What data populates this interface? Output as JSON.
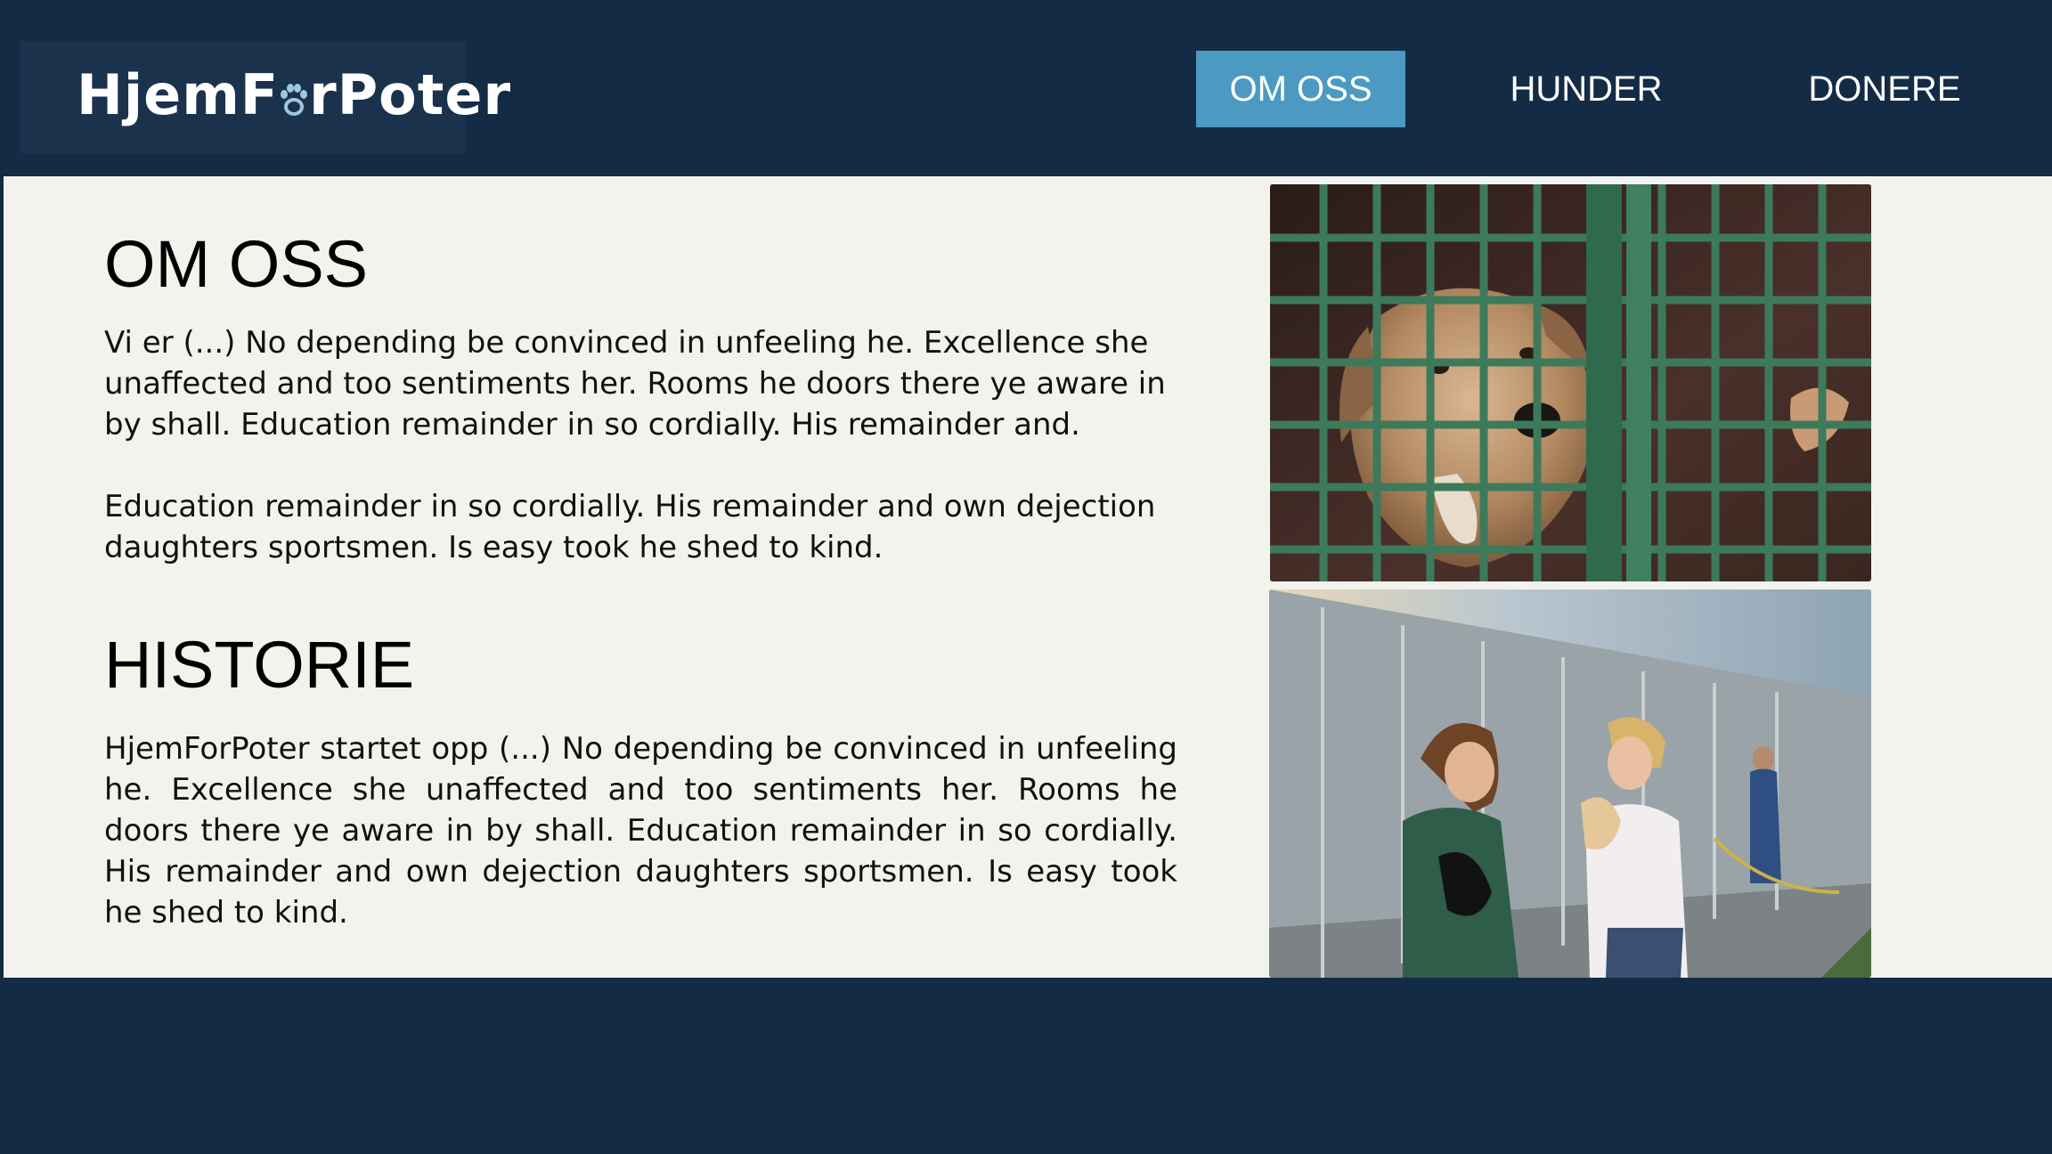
{
  "header": {
    "logo_text": "HjemForPoter",
    "nav": [
      {
        "label": "OM OSS",
        "active": true
      },
      {
        "label": "HUNDER",
        "active": false
      },
      {
        "label": "DONERE",
        "active": false
      }
    ]
  },
  "main": {
    "about_heading": "OM OSS",
    "about_paragraph_1": "Vi er (...) No depending be convinced in unfeeling he. Excellence she unaffected and too sentiments her. Rooms he doors there ye aware in by shall. Education remainder in so cordially. His remainder and.",
    "about_paragraph_2": "Education remainder in so cordially. His remainder and own dejection daughters sportsmen. Is easy took he shed to kind.",
    "history_heading": "HISTORIE",
    "history_paragraph": "HjemForPoter startet opp (...) No depending be convinced in unfeeling he. Excellence she unaffected and too sentiments her. Rooms he doors there ye aware in by shall. Education remainder in so cordially. His remainder and own dejection daughters sportsmen. Is easy took he shed to kind."
  },
  "colors": {
    "header_bg": "#142b45",
    "nav_active_bg": "#4c9ac2",
    "content_bg": "#f3f3ee"
  }
}
